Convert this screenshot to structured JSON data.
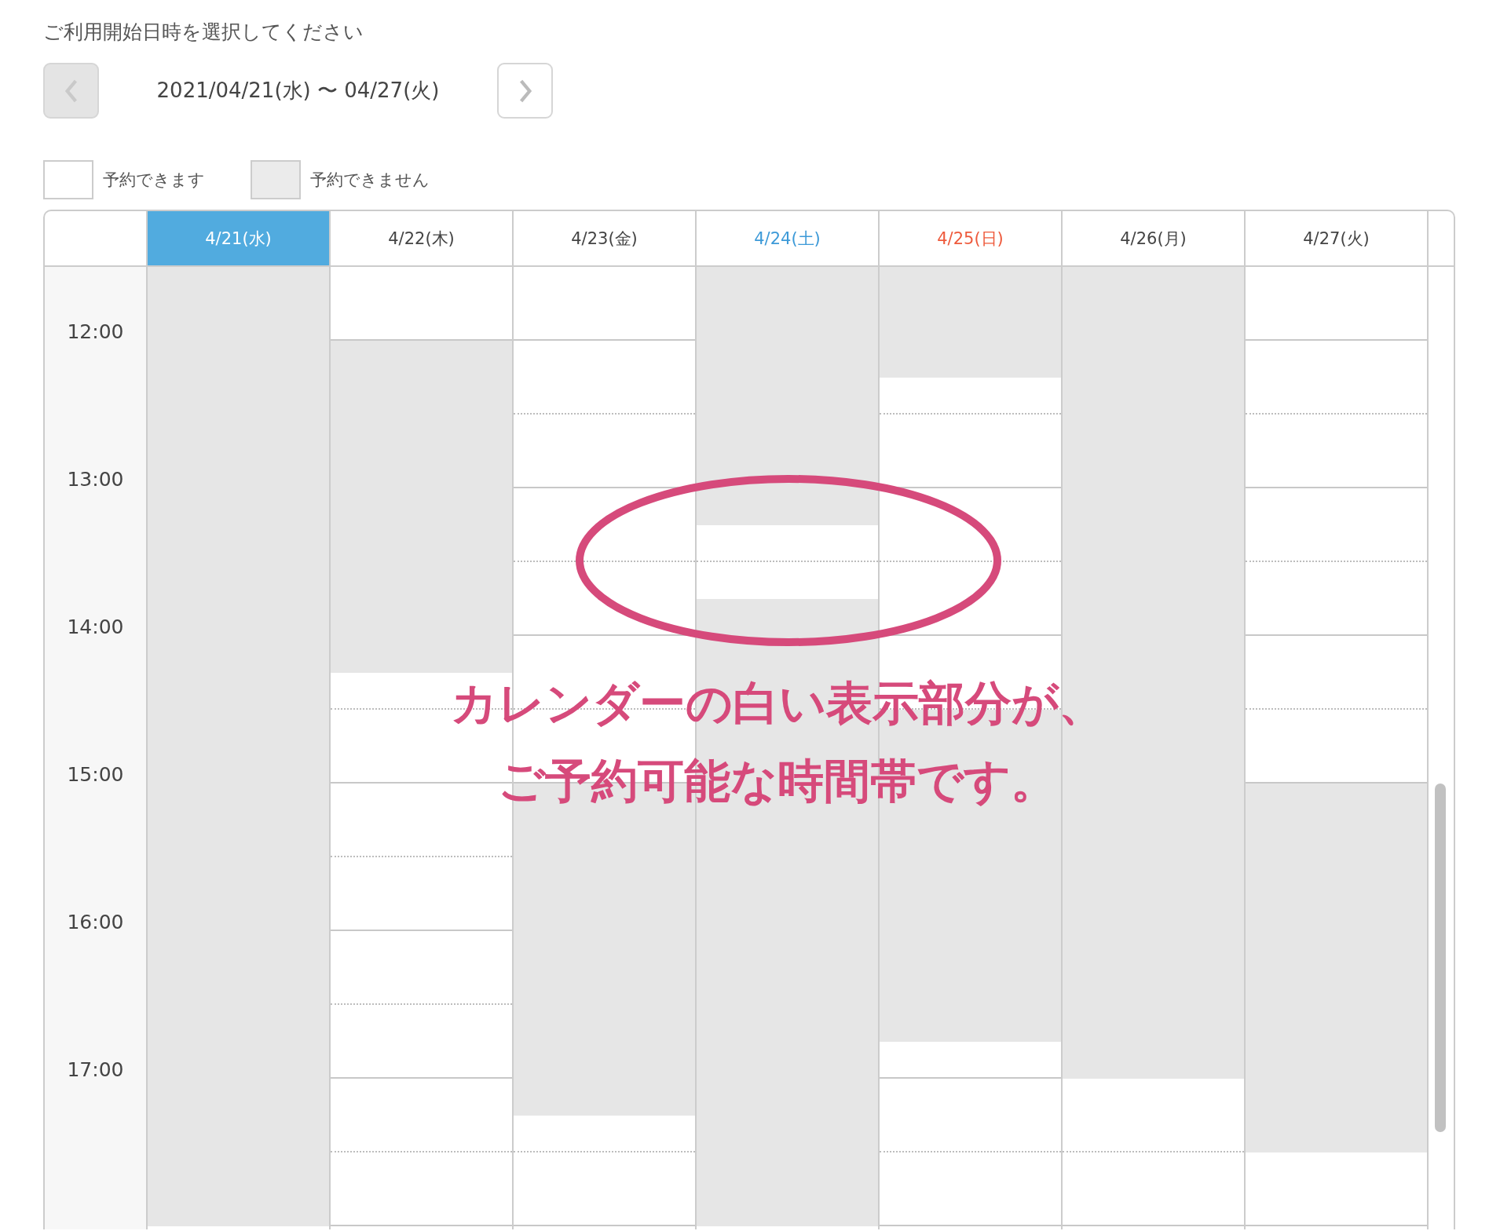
{
  "heading": "ご利用開始日時を選択してください",
  "nav": {
    "prev": {
      "disabled": true
    },
    "range": "2021/04/21(水) 〜 04/27(火)",
    "next": {
      "disabled": false
    }
  },
  "legend": [
    {
      "kind": "available",
      "label": "予約できます"
    },
    {
      "kind": "unavailable",
      "label": "予約できません"
    }
  ],
  "times": [
    "12:00",
    "13:00",
    "14:00",
    "15:00",
    "16:00",
    "17:00"
  ],
  "days": [
    {
      "label": "4/21(水)",
      "kind": "weekday",
      "selected": true,
      "slots": [
        {
          "available": false
        },
        {
          "available": false
        },
        {
          "available": false
        },
        {
          "available": false
        },
        {
          "available": false
        },
        {
          "available": false
        },
        {
          "available": false
        },
        {
          "available": false
        },
        {
          "available": false
        },
        {
          "available": false
        },
        {
          "available": false
        },
        {
          "available": false
        },
        {
          "available": false
        },
        {
          "available": false
        },
        {
          "available": false
        },
        {
          "available": false
        },
        {
          "available": false
        },
        {
          "available": false
        },
        {
          "available": false
        },
        {
          "available": false
        },
        {
          "available": false
        },
        {
          "available": false
        },
        {
          "available": false
        },
        {
          "available": false
        },
        {
          "available": false
        },
        {
          "available": false
        }
      ]
    },
    {
      "label": "4/22(木)",
      "kind": "weekday",
      "selected": false,
      "slots": [
        {
          "available": true
        },
        {
          "available": true
        },
        {
          "available": false
        },
        {
          "available": false
        },
        {
          "available": false
        },
        {
          "available": false
        },
        {
          "available": false
        },
        {
          "available": false
        },
        {
          "available": false
        },
        {
          "available": false
        },
        {
          "available": false
        },
        {
          "available": true
        },
        {
          "available": true
        },
        {
          "available": true
        },
        {
          "available": true
        },
        {
          "available": true
        },
        {
          "available": true
        },
        {
          "available": true
        },
        {
          "available": true
        },
        {
          "available": true
        },
        {
          "available": true
        },
        {
          "available": true
        },
        {
          "available": true
        },
        {
          "available": true
        },
        {
          "available": true
        },
        {
          "available": true
        }
      ]
    },
    {
      "label": "4/23(金)",
      "kind": "weekday",
      "selected": false,
      "slots": [
        {
          "available": true
        },
        {
          "available": true
        },
        {
          "available": true
        },
        {
          "available": true
        },
        {
          "available": true
        },
        {
          "available": true
        },
        {
          "available": true
        },
        {
          "available": true
        },
        {
          "available": true
        },
        {
          "available": true
        },
        {
          "available": true
        },
        {
          "available": true
        },
        {
          "available": true
        },
        {
          "available": true
        },
        {
          "available": false
        },
        {
          "available": false
        },
        {
          "available": false
        },
        {
          "available": false
        },
        {
          "available": false
        },
        {
          "available": false
        },
        {
          "available": false
        },
        {
          "available": false
        },
        {
          "available": false
        },
        {
          "available": true
        },
        {
          "available": true
        },
        {
          "available": true
        }
      ]
    },
    {
      "label": "4/24(土)",
      "kind": "saturday",
      "selected": false,
      "slots": [
        {
          "available": false
        },
        {
          "available": false
        },
        {
          "available": false
        },
        {
          "available": false
        },
        {
          "available": false
        },
        {
          "available": false
        },
        {
          "available": false
        },
        {
          "available": true
        },
        {
          "available": true
        },
        {
          "available": false
        },
        {
          "available": false
        },
        {
          "available": false
        },
        {
          "available": false
        },
        {
          "available": false
        },
        {
          "available": false
        },
        {
          "available": false
        },
        {
          "available": false
        },
        {
          "available": false
        },
        {
          "available": false
        },
        {
          "available": false
        },
        {
          "available": false
        },
        {
          "available": false
        },
        {
          "available": false
        },
        {
          "available": false
        },
        {
          "available": false
        },
        {
          "available": false
        }
      ]
    },
    {
      "label": "4/25(日)",
      "kind": "sunday",
      "selected": false,
      "slots": [
        {
          "available": false
        },
        {
          "available": false
        },
        {
          "available": false
        },
        {
          "available": true
        },
        {
          "available": true
        },
        {
          "available": true
        },
        {
          "available": true
        },
        {
          "available": true
        },
        {
          "available": true
        },
        {
          "available": true
        },
        {
          "available": true
        },
        {
          "available": true
        },
        {
          "available": false
        },
        {
          "available": false
        },
        {
          "available": false
        },
        {
          "available": false
        },
        {
          "available": false
        },
        {
          "available": false
        },
        {
          "available": false
        },
        {
          "available": false
        },
        {
          "available": false
        },
        {
          "available": true
        },
        {
          "available": true
        },
        {
          "available": true
        },
        {
          "available": true
        },
        {
          "available": true
        }
      ]
    },
    {
      "label": "4/26(月)",
      "kind": "weekday",
      "selected": false,
      "slots": [
        {
          "available": false
        },
        {
          "available": false
        },
        {
          "available": false
        },
        {
          "available": false
        },
        {
          "available": false
        },
        {
          "available": false
        },
        {
          "available": false
        },
        {
          "available": false
        },
        {
          "available": false
        },
        {
          "available": false
        },
        {
          "available": false
        },
        {
          "available": false
        },
        {
          "available": false
        },
        {
          "available": false
        },
        {
          "available": false
        },
        {
          "available": false
        },
        {
          "available": false
        },
        {
          "available": false
        },
        {
          "available": false
        },
        {
          "available": false
        },
        {
          "available": false
        },
        {
          "available": false
        },
        {
          "available": true
        },
        {
          "available": true
        },
        {
          "available": true
        },
        {
          "available": true
        }
      ]
    },
    {
      "label": "4/27(火)",
      "kind": "weekday",
      "selected": false,
      "slots": [
        {
          "available": true
        },
        {
          "available": true
        },
        {
          "available": true
        },
        {
          "available": true
        },
        {
          "available": true
        },
        {
          "available": true
        },
        {
          "available": true
        },
        {
          "available": true
        },
        {
          "available": true
        },
        {
          "available": true
        },
        {
          "available": true
        },
        {
          "available": true
        },
        {
          "available": true
        },
        {
          "available": true
        },
        {
          "available": false
        },
        {
          "available": false
        },
        {
          "available": false
        },
        {
          "available": false
        },
        {
          "available": false
        },
        {
          "available": false
        },
        {
          "available": false
        },
        {
          "available": false
        },
        {
          "available": false
        },
        {
          "available": false
        },
        {
          "available": true
        },
        {
          "available": true
        }
      ]
    }
  ],
  "annotation": {
    "lines": [
      "カレンダーの白い表示部分が、",
      "ご予約可能な時間帯です。"
    ]
  }
}
